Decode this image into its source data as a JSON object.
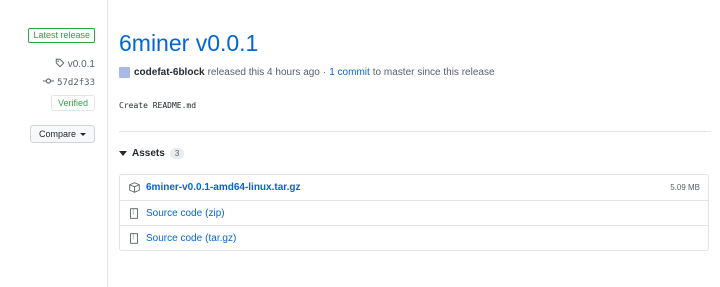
{
  "sidebar": {
    "latest_label": "Latest release",
    "tag": "v0.0.1",
    "commit": "57d2f33",
    "verified_label": "Verified",
    "compare_label": "Compare"
  },
  "release": {
    "title": "6miner v0.0.1",
    "author": "codefat-6block",
    "released_text": "released this 4 hours ago",
    "separator": "·",
    "commits_link": "1 commit",
    "commits_suffix": "to master since this release",
    "body": "Create README.md"
  },
  "assets": {
    "heading": "Assets",
    "count": "3",
    "items": [
      {
        "icon": "package-icon",
        "name": "6miner-v0.0.1-amd64-linux.tar.gz",
        "suffix": "",
        "size": "5.09 MB"
      },
      {
        "icon": "file-zip-icon",
        "name": "Source code",
        "suffix": "(zip)",
        "size": ""
      },
      {
        "icon": "file-zip-icon",
        "name": "Source code",
        "suffix": "(tar.gz)",
        "size": ""
      }
    ]
  },
  "colors": {
    "link": "#0366d6",
    "success": "#28a745",
    "muted": "#586069",
    "border": "#e1e4e8"
  }
}
